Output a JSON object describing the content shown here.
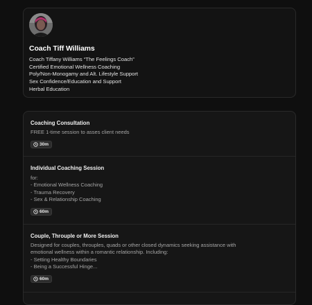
{
  "profile": {
    "avatar_icon": "user-photo",
    "name": "Coach Tiff Williams",
    "bio": [
      "Coach Tiffany Williams “The Feelings Coach”",
      "Certified Emotional Wellness Coaching",
      "Poly/Non-Monogamy and Alt. Lifestyle Support",
      "Sex Confidence/Education and Support",
      "Herbal Education"
    ]
  },
  "events": [
    {
      "title": "Coaching Consultation",
      "description": "FREE 1-time session to asses client needs",
      "duration": "30m"
    },
    {
      "title": "Individual Coaching Session",
      "description": "for:\n- Emotional Wellness Coaching\n- Trauma Recovery\n- Sex & Relationship Coaching",
      "duration": "60m"
    },
    {
      "title": "Couple, Throuple or More Session",
      "description": "Designed for couples, throuples, quads or other closed dynamics seeking assistance with emotional wellness within a romantic relationship. Including:\n- Setting Healthy Boundaries\n- Being a Successful Hinge...",
      "duration": "60m"
    }
  ],
  "icons": {
    "duration": "clock-icon"
  }
}
